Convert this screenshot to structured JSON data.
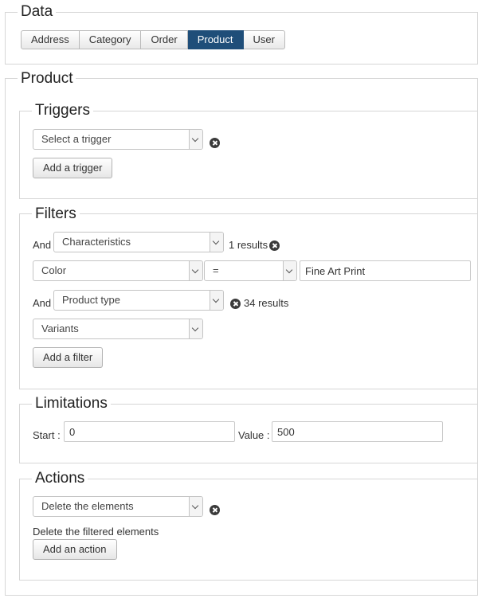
{
  "data_section": {
    "legend": "Data",
    "tabs": [
      {
        "label": "Address",
        "active": false
      },
      {
        "label": "Category",
        "active": false
      },
      {
        "label": "Order",
        "active": false
      },
      {
        "label": "Product",
        "active": true
      },
      {
        "label": "User",
        "active": false
      }
    ]
  },
  "product_section": {
    "legend": "Product",
    "triggers": {
      "legend": "Triggers",
      "select_value": "Select a trigger",
      "add_button": "Add a trigger"
    },
    "filters": {
      "legend": "Filters",
      "row1": {
        "prefix": "And",
        "select_value": "Characteristics",
        "results": "1 results"
      },
      "row2": {
        "field": "Color",
        "operator": "=",
        "value": "Fine Art Print"
      },
      "row3": {
        "prefix": "And",
        "select_value": "Product type",
        "results": "34 results"
      },
      "row4": {
        "select_value": "Variants"
      },
      "add_button": "Add a filter"
    },
    "limitations": {
      "legend": "Limitations",
      "start_label": "Start :",
      "start_value": "0",
      "value_label": "Value :",
      "value_value": "500"
    },
    "actions": {
      "legend": "Actions",
      "select_value": "Delete the elements",
      "description": "Delete the filtered elements",
      "add_button": "Add an action"
    }
  },
  "colors": {
    "active_tab": "#1f4e79",
    "border": "#d6d6d6"
  }
}
